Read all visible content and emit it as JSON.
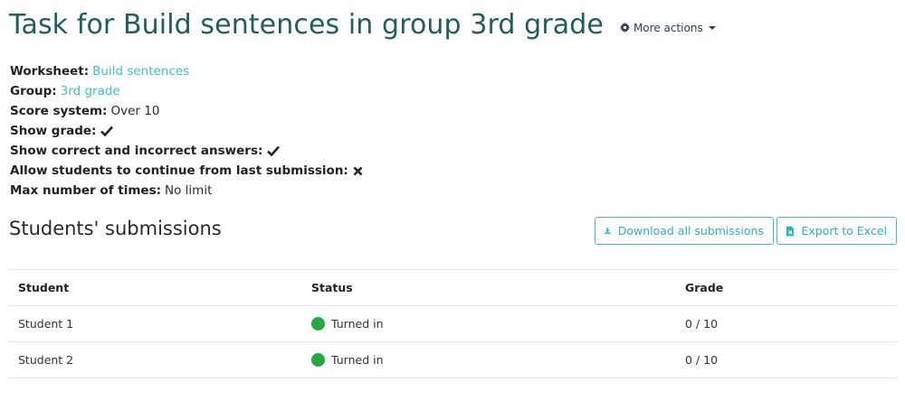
{
  "page": {
    "title": "Task for Build sentences in group 3rd grade",
    "more_actions": "More actions"
  },
  "details": {
    "worksheet_label": "Worksheet:",
    "worksheet_value": "Build sentences",
    "group_label": "Group:",
    "group_value": "3rd grade",
    "score_label": "Score system:",
    "score_value": "Over 10",
    "show_grade_label": "Show grade:",
    "show_answers_label": "Show correct and incorrect answers:",
    "allow_continue_label": "Allow students to continue from last submission:",
    "max_times_label": "Max number of times:",
    "max_times_value": "No limit"
  },
  "submissions": {
    "title": "Students' submissions",
    "download_label": "Download all submissions",
    "export_label": "Export to Excel",
    "columns": [
      "Student",
      "Status",
      "Grade"
    ],
    "rows": [
      {
        "student": "Student 1",
        "status": "Turned in",
        "grade": "0 / 10"
      },
      {
        "student": "Student 2",
        "status": "Turned in",
        "grade": "0 / 10"
      }
    ]
  },
  "colors": {
    "title": "#1f5d5f",
    "link": "#3cc0cc",
    "status_turned_in": "#28a745"
  },
  "icons": {
    "more_actions": "gear-icon",
    "download": "download-icon",
    "export": "excel-file-icon",
    "yes": "check-icon",
    "no": "cross-icon"
  }
}
